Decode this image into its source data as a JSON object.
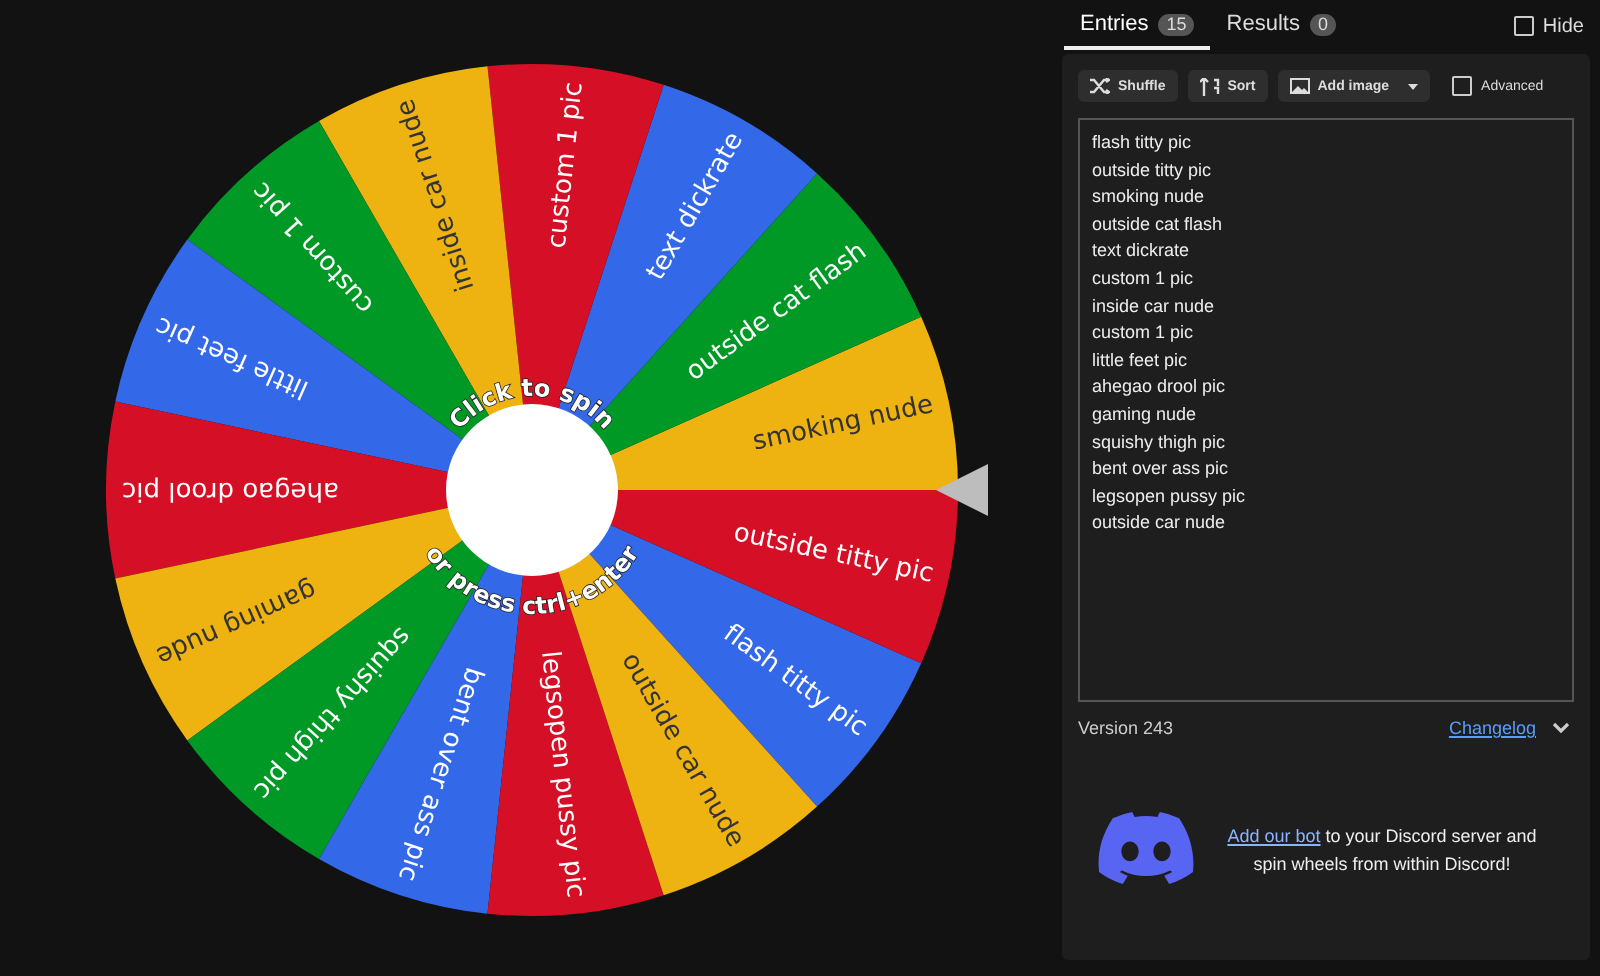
{
  "wheel": {
    "top_caption": "Click to spin",
    "bottom_caption": "or press ctrl+enter",
    "slices": [
      {
        "label": "flash titty pic",
        "color": "#3369e8"
      },
      {
        "label": "outside titty pic",
        "color": "#d50f25"
      },
      {
        "label": "smoking nude",
        "color": "#eeb211"
      },
      {
        "label": "outside cat flash",
        "color": "#009925"
      },
      {
        "label": "text dickrate",
        "color": "#3369e8"
      },
      {
        "label": "custom 1 pic",
        "color": "#d50f25"
      },
      {
        "label": "inside car nude",
        "color": "#eeb211"
      },
      {
        "label": "custom 1 pic",
        "color": "#009925"
      },
      {
        "label": "little feet pic",
        "color": "#3369e8"
      },
      {
        "label": "ahegao drool pic",
        "color": "#d50f25"
      },
      {
        "label": "gaming nude",
        "color": "#eeb211"
      },
      {
        "label": "squishy thigh pic",
        "color": "#009925"
      },
      {
        "label": "bent over ass pic",
        "color": "#3369e8"
      },
      {
        "label": "legsopen pussy pic",
        "color": "#d50f25"
      },
      {
        "label": "outside car nude",
        "color": "#eeb211"
      }
    ]
  },
  "tabs": [
    {
      "label": "Entries",
      "count": "15",
      "selected": true
    },
    {
      "label": "Results",
      "count": "0",
      "selected": false
    }
  ],
  "hide": {
    "label": "Hide",
    "checked": false
  },
  "toolbar": {
    "shuffle": "Shuffle",
    "sort": "Sort",
    "add_image": "Add image",
    "advanced": {
      "label": "Advanced",
      "checked": false
    }
  },
  "entries": [
    "flash titty pic",
    "outside titty pic",
    "smoking nude",
    "outside cat flash",
    "text dickrate",
    "custom 1 pic",
    "inside car nude",
    "custom 1 pic",
    "little feet pic",
    "ahegao drool pic",
    "gaming nude",
    "squishy thigh pic",
    "bent over ass pic",
    "legsopen pussy pic",
    "outside car nude"
  ],
  "version": "Version 243",
  "changelog": "Changelog",
  "discord": {
    "link": "Add our bot",
    "text": " to your Discord server and spin wheels from within Discord!"
  }
}
